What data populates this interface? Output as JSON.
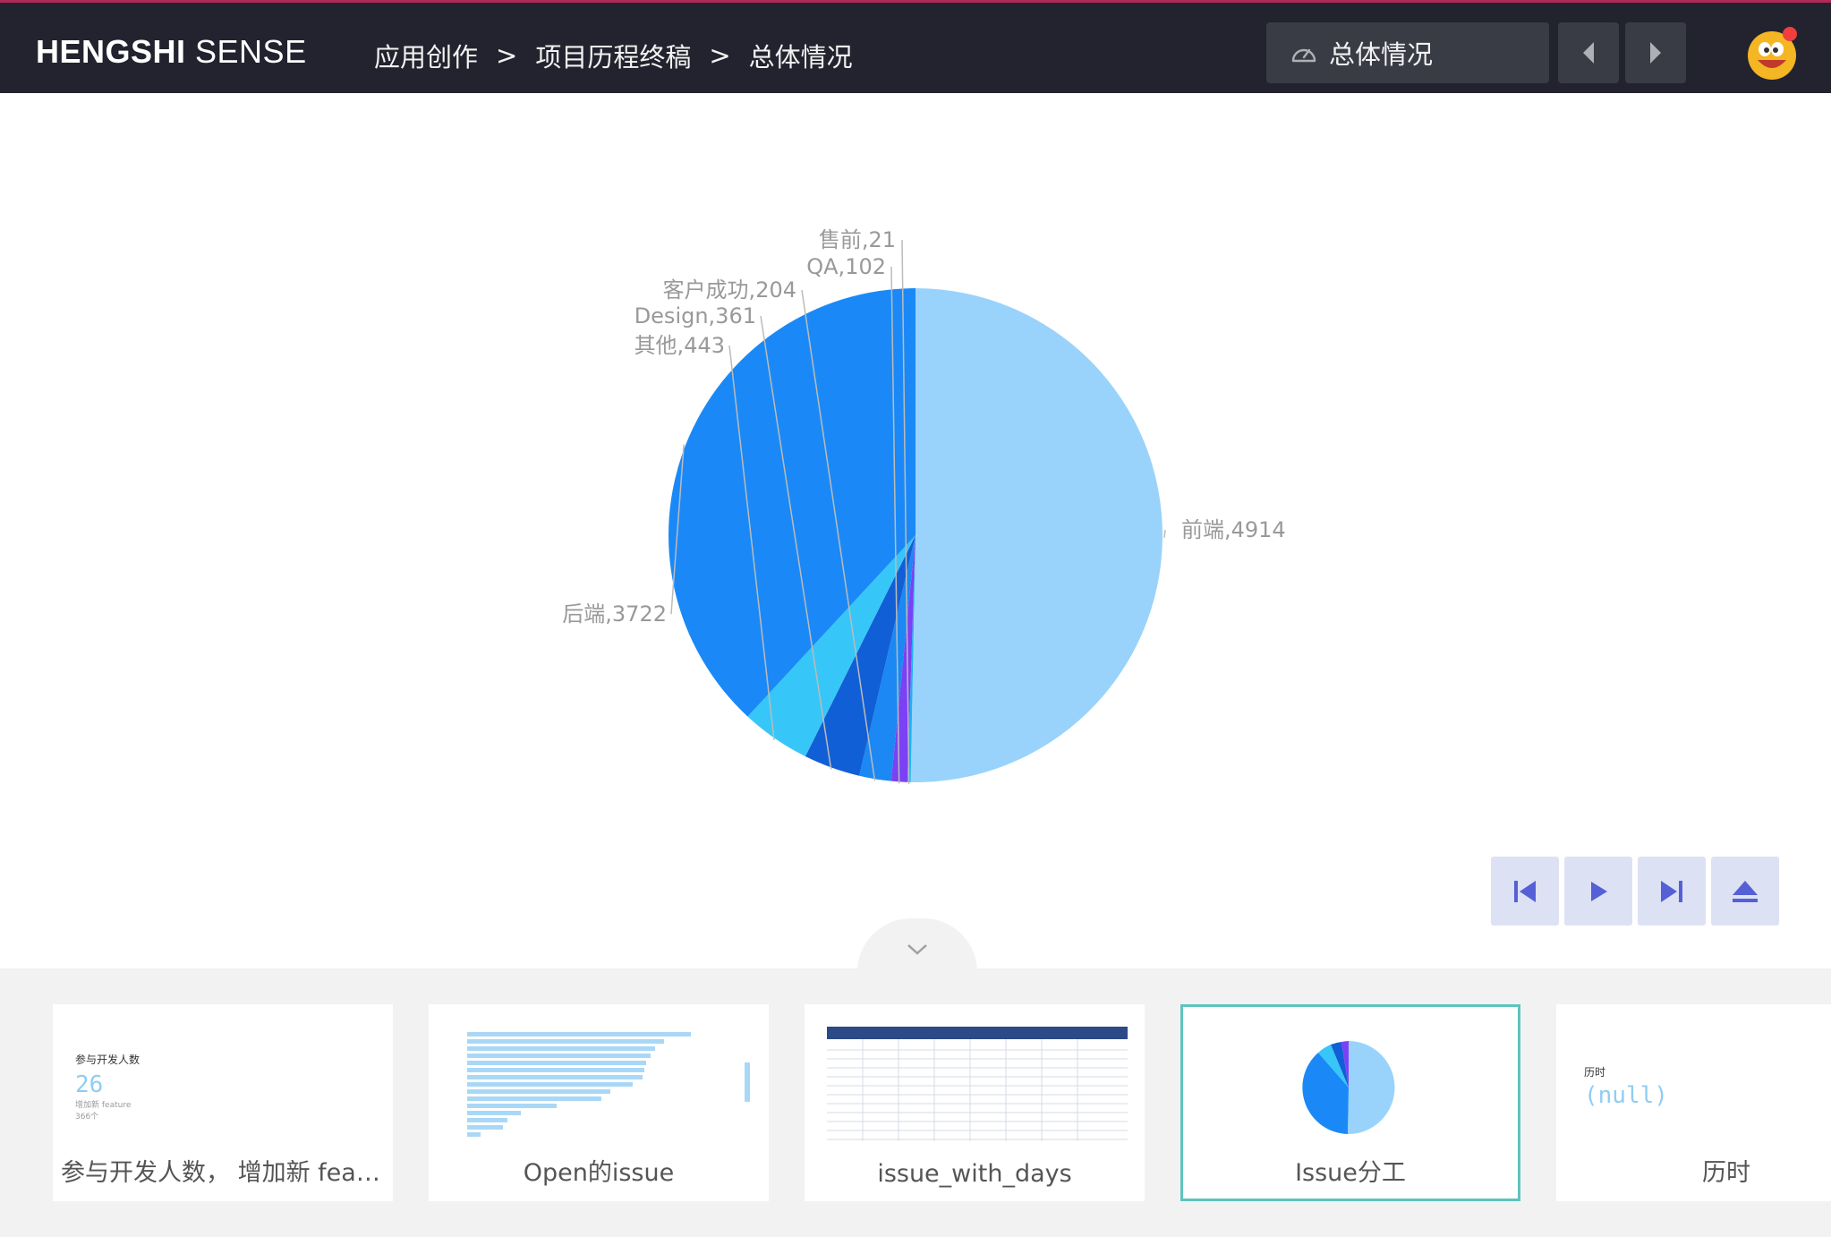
{
  "header": {
    "brand_bold": "HENGSHI",
    "brand_light": " SENSE",
    "breadcrumb": [
      "应用创作",
      "项目历程终稿",
      "总体情况"
    ],
    "breadcrumb_sep": ">",
    "dashboard_select": {
      "icon": "gauge-icon",
      "value": "总体情况"
    },
    "prev_icon": "caret-left-icon",
    "next_icon": "caret-right-icon",
    "avatar_icon": "emoji-avatar"
  },
  "chart_data": {
    "type": "pie",
    "categories": [
      "前端",
      "售前",
      "QA",
      "客户成功",
      "Design",
      "其他",
      "后端"
    ],
    "values": [
      4914,
      21,
      102,
      204,
      361,
      443,
      3722
    ],
    "labels": [
      "前端,4914",
      "售前,21",
      "QA,102",
      "客户成功,204",
      "Design,361",
      "其他,443",
      "后端,3722"
    ],
    "colors": [
      "#99d3fb",
      "#1bb2f7",
      "#7b41f5",
      "#1b88f3",
      "#115fd6",
      "#36c7f8",
      "#1a89f7"
    ]
  },
  "playback": {
    "first": "skip-to-first-icon",
    "play": "play-icon",
    "last": "skip-to-last-icon",
    "eject": "eject-icon"
  },
  "strip": {
    "collapse_icon": "chevron-down-icon",
    "thumbnails": [
      {
        "caption": "参与开发人数， 增加新 feat...",
        "kpi_title": "参与开发人数",
        "kpi_value": "26",
        "kpi_sub1": "增加新 feature",
        "kpi_sub2": "366个"
      },
      {
        "caption": "Open的issue"
      },
      {
        "caption": "issue_with_days"
      },
      {
        "caption": "Issue分工"
      },
      {
        "caption": "历时",
        "kpi_title": "历时",
        "kpi_value": "(null)"
      }
    ]
  }
}
